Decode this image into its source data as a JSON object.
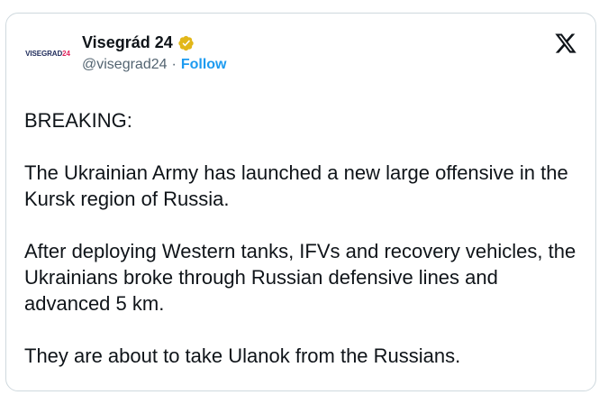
{
  "author": {
    "avatar_text_main": "VISEGRAD",
    "avatar_text_accent": "24",
    "display_name": "Visegrád 24",
    "handle": "@visegrad24",
    "separator": "·",
    "follow_label": "Follow",
    "verified_icon": "verified-badge-icon",
    "verified_color": "#e2b719"
  },
  "brand_icon": "x-logo-icon",
  "post": {
    "paragraphs": [
      "BREAKING:",
      "The Ukrainian Army has launched a new large offensive in the Kursk region of Russia.",
      "After deploying Western tanks, IFVs and recovery vehicles, the Ukrainians broke through Russian defensive lines and advanced 5 km.",
      "They are about to take Ulanok from the Russians."
    ]
  },
  "colors": {
    "link": "#1d9bf0",
    "secondary_text": "#536471",
    "border": "#cfd9de"
  }
}
